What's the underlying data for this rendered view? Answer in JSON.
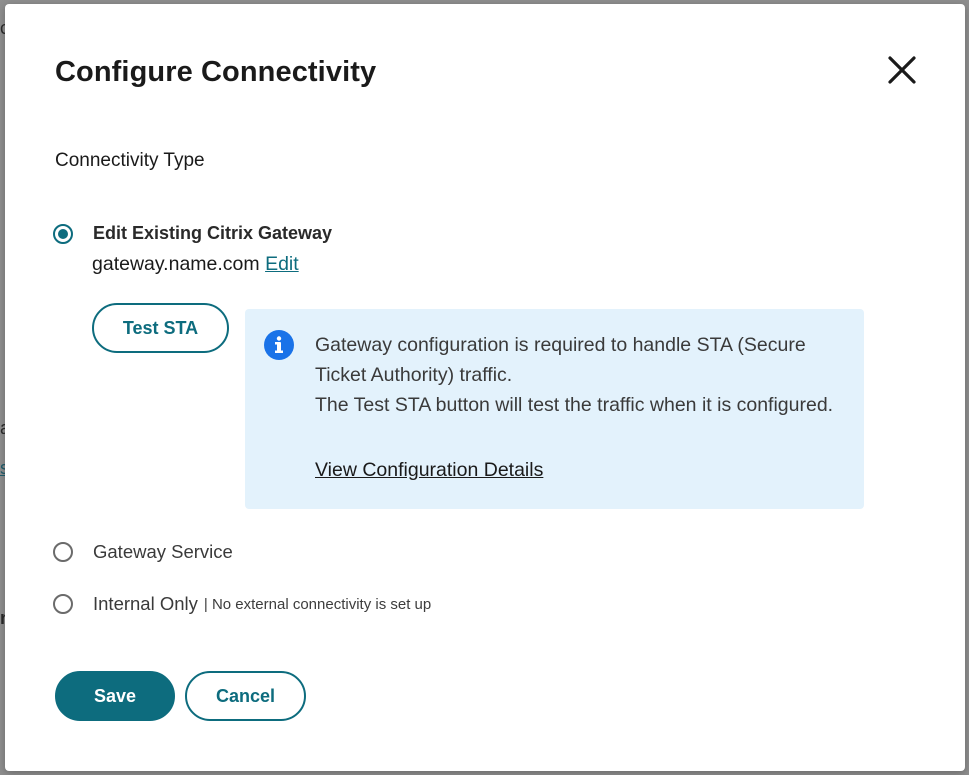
{
  "dialog": {
    "title": "Configure Connectivity",
    "close_icon": "close-icon"
  },
  "connectivity": {
    "section_label": "Connectivity Type",
    "options": [
      {
        "label": "Edit Existing Citrix Gateway",
        "selected": true
      },
      {
        "label": "Gateway Service",
        "selected": false
      },
      {
        "label": "Internal Only",
        "sublabel": "| No external connectivity is set up",
        "selected": false
      }
    ],
    "gateway_name": "gateway.name.com",
    "edit_link": "Edit",
    "test_sta_label": "Test STA"
  },
  "info": {
    "icon": "info-icon",
    "line1": "Gateway configuration is required to handle STA (Secure Ticket Authority) traffic.",
    "line2": "The Test STA button will test the traffic when it is configured.",
    "link": "View Configuration Details"
  },
  "footer": {
    "save_label": "Save",
    "cancel_label": "Cancel"
  },
  "colors": {
    "accent": "#0d6c7e",
    "info_bg": "#e3f2fc",
    "info_icon": "#1a73e8"
  }
}
